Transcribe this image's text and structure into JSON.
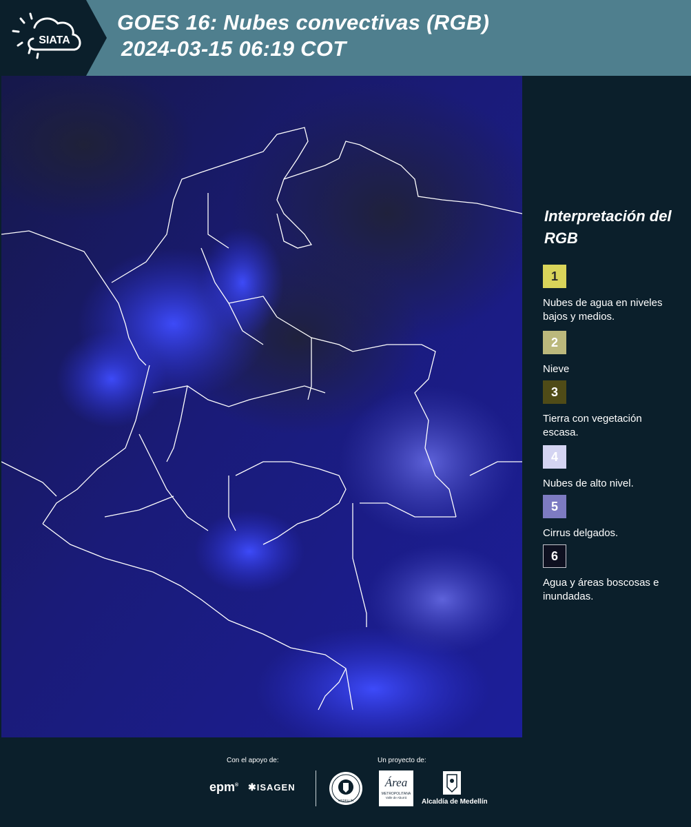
{
  "header": {
    "logo_text": "SIATA",
    "title_line1": "GOES 16: Nubes convectivas (RGB)",
    "title_line2": "2024-03-15 06:19 COT",
    "background_color": "#4f7f8e"
  },
  "map": {
    "type": "satellite-rgb",
    "region": "Colombia",
    "dominant_color": "#1a1d8c",
    "cloud_color": "#3a48ff",
    "boundary_color": "#ffffff"
  },
  "legend": {
    "title": "Interpretación del RGB",
    "items": [
      {
        "number": "1",
        "label": "Nubes de agua en niveles bajos y medios.",
        "color": "#d9d45a",
        "text_color": "#2a2a2a"
      },
      {
        "number": "2",
        "label": "Nieve",
        "color": "#bbb87c",
        "text_color": "#ffffff"
      },
      {
        "number": "3",
        "label": "Tierra con vegetación escasa.",
        "color": "#4f4b17",
        "text_color": "#ffffff"
      },
      {
        "number": "4",
        "label": "Nubes de alto nivel.",
        "color": "#d4d4f2",
        "text_color": "#ffffff"
      },
      {
        "number": "5",
        "label": "Cirrus delgados.",
        "color": "#7d7bc2",
        "text_color": "#ffffff"
      },
      {
        "number": "6",
        "label": "Agua y áreas boscosas e inundadas.",
        "color": "#0e1020",
        "text_color": "#ffffff"
      }
    ]
  },
  "footer": {
    "support_label": "Con el apoyo de:",
    "project_label": "Un proyecto de:",
    "sponsor_epm": "epm",
    "sponsor_isagen": "ISAGEN",
    "partner_area_name": "Área",
    "partner_area_sub": "METROPOLITANA",
    "partner_area_sub2": "Valle de Aburrá",
    "partner_alcaldia": "Alcaldía de Medellín",
    "seal_text": "MEDELLÍN"
  }
}
